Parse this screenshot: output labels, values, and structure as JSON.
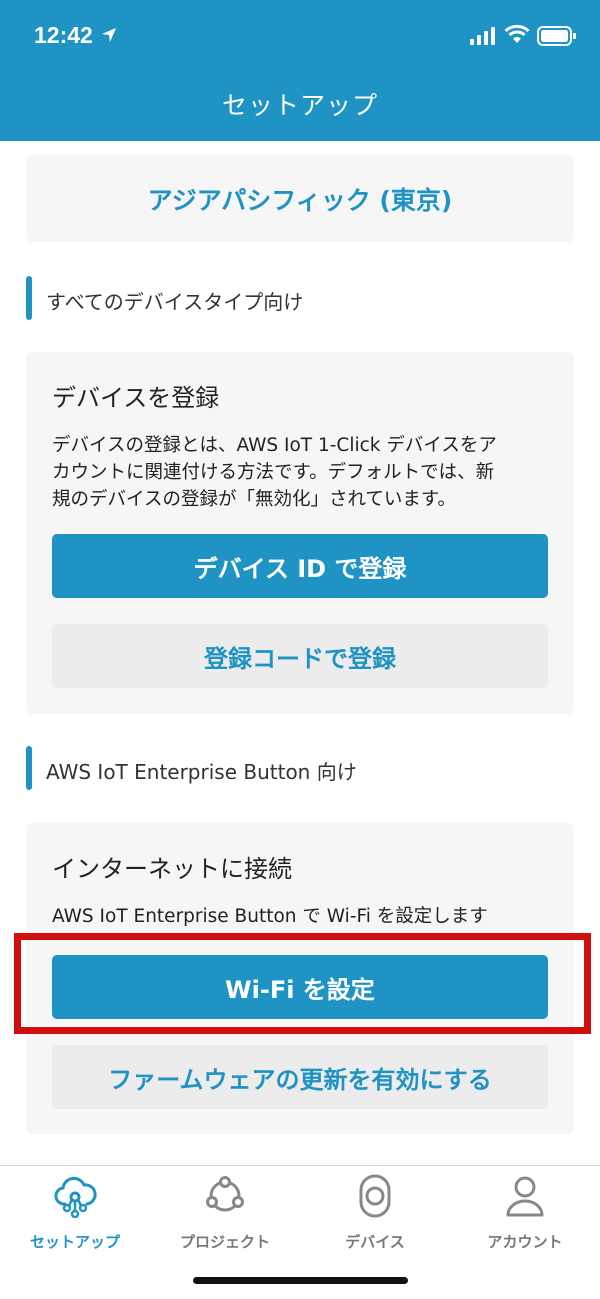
{
  "status_bar": {
    "time": "12:42"
  },
  "header": {
    "title": "セットアップ"
  },
  "region": {
    "label": "アジアパシフィック (東京)"
  },
  "section_all": {
    "label": "すべてのデバイスタイプ向け"
  },
  "register_card": {
    "title": "デバイスを登録",
    "desc_line1": "デバイスの登録とは、AWS IoT 1-Click デバイスをア",
    "desc_line2": "カウントに関連付ける方法です。デフォルトでは、新",
    "desc_line3": "規のデバイスの登録が「無効化」されています。",
    "by_id_button": "デバイス ID で登録",
    "by_code_button": "登録コードで登録"
  },
  "section_enterprise": {
    "label": "AWS IoT Enterprise Button 向け"
  },
  "connect_card": {
    "title": "インターネットに接続",
    "desc": "AWS IoT Enterprise Button で Wi-Fi を設定します",
    "wifi_button": "Wi-Fi を設定",
    "firmware_button": "ファームウェアの更新を有効にする"
  },
  "tabbar": {
    "items": [
      {
        "label": "セットアップ",
        "icon": "cloud-setup-icon",
        "active": true
      },
      {
        "label": "プロジェクト",
        "icon": "project-nodes-icon",
        "active": false
      },
      {
        "label": "デバイス",
        "icon": "device-button-icon",
        "active": false
      },
      {
        "label": "アカウント",
        "icon": "person-icon",
        "active": false
      }
    ]
  },
  "colors": {
    "accent": "#1f93c4",
    "highlight": "#d0100e"
  }
}
